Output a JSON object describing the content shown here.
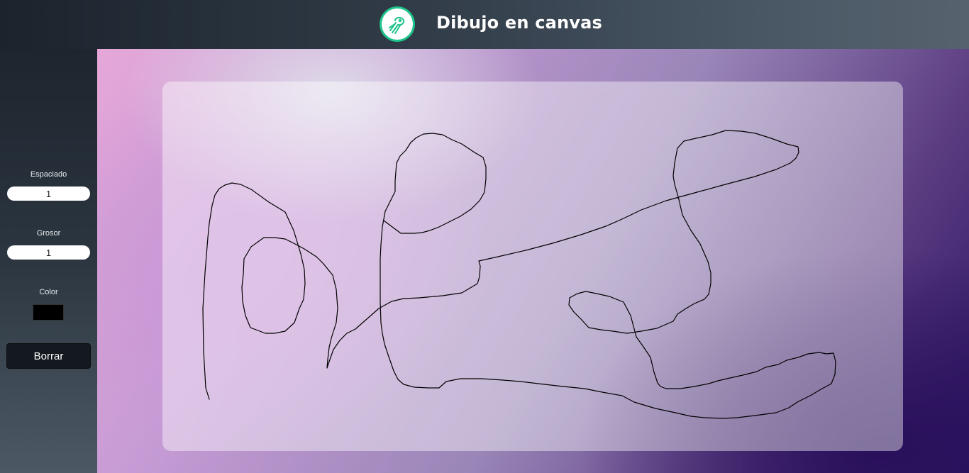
{
  "header": {
    "title": "Dibujo en canvas",
    "logo_icon": "jellyfish-icon",
    "accent_color": "#1ec38b"
  },
  "sidebar": {
    "spacing": {
      "label": "Espaciado",
      "value": "1"
    },
    "thickness": {
      "label": "Grosor",
      "value": "1"
    },
    "color": {
      "label": "Color",
      "value": "#000000"
    },
    "clear_button": "Borrar"
  }
}
